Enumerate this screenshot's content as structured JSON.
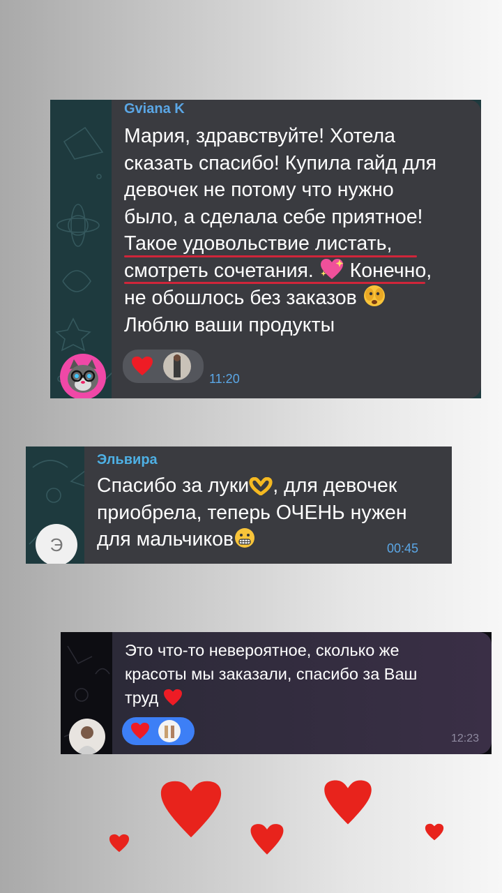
{
  "messages": [
    {
      "sender": "Gviana K",
      "text": "Мария, здравствуйте! Хотела\nсказать спасибо! Купила гайд для\nдевочек не потому что нужно\nбыло, а сделала себе приятное!\nТакое удовольствие листать,\nсмотреть сочетания.",
      "text_after": " Конечно,\nне обошлось без заказов ",
      "text_end": "\nЛюблю ваши продукты",
      "time": "11:20",
      "reaction_emoji": "heart",
      "avatar_icon": "cat-with-glasses-avatar",
      "sender_color": "#5ba7e6"
    },
    {
      "sender": "Эльвира",
      "text": "Спасибо за луки",
      "text_after": ", для девочек\nприобрела, теперь ОЧЕНЬ нужен\nдля мальчиков",
      "time": "00:45",
      "avatar_letter": "Э",
      "sender_color": "#4eb0e4"
    },
    {
      "text": "Это что-то невероятное, сколько же\nкрасоты мы заказали, спасибо за Ваш\nтруд ",
      "time": "12:23",
      "reaction_emoji": "heart",
      "reaction_pill_color": "#3d7ff6"
    }
  ],
  "colors": {
    "bubble_dark": "#3a3b40",
    "chat_bg_teal": "#1e3a3e",
    "chat_bg_dark": "#0d0d12",
    "underline": "#d0253a",
    "heart_red": "#e8231c"
  }
}
